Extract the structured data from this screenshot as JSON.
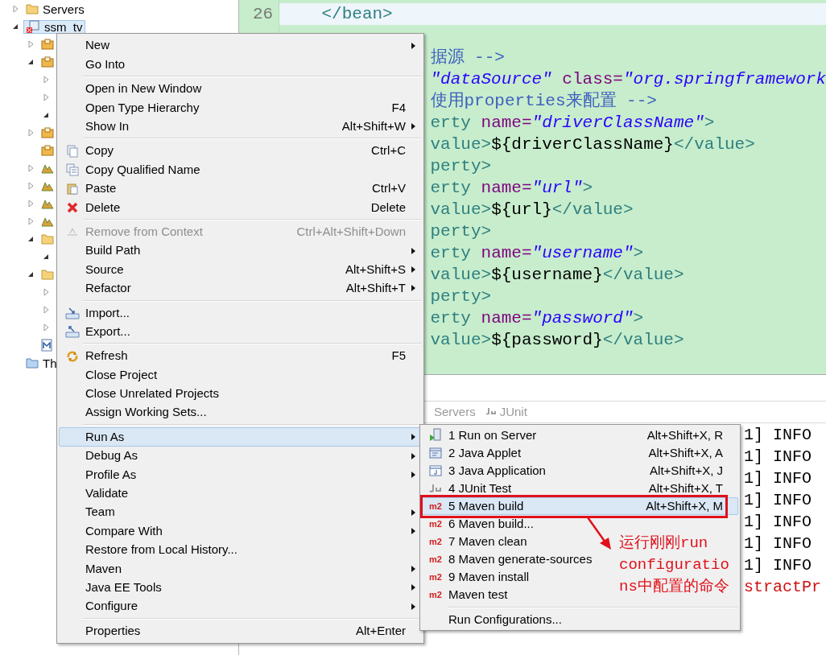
{
  "project_explorer": {
    "items": [
      {
        "label": "Servers",
        "kind": "folder",
        "expanded": false,
        "selected": false
      },
      {
        "label": "ssm_tv",
        "kind": "project",
        "expanded": true,
        "selected": true,
        "children": [
          {
            "kind": "package",
            "expanded": false,
            "selected": false
          },
          {
            "kind": "package",
            "expanded": true,
            "selected": false,
            "children": [
              {
                "expanded": false,
                "selected": false
              },
              {
                "expanded": false,
                "selected": false
              },
              {
                "expanded": true,
                "selected": false
              }
            ]
          },
          {
            "kind": "package",
            "expanded": false,
            "selected": false
          },
          {
            "kind": "package",
            "selected": false
          },
          {
            "kind": "library",
            "expanded": false,
            "selected": false
          },
          {
            "kind": "library",
            "expanded": false,
            "selected": false
          },
          {
            "kind": "library",
            "expanded": false,
            "selected": false
          },
          {
            "kind": "library",
            "expanded": false,
            "selected": false
          },
          {
            "kind": "folder",
            "expanded": true,
            "selected": false,
            "children": [
              {
                "expanded": true,
                "selected": false
              }
            ]
          },
          {
            "kind": "folder",
            "expanded": true,
            "selected": false,
            "children": [
              {
                "expanded": false,
                "selected": false
              },
              {
                "expanded": false,
                "selected": false
              },
              {
                "expanded": false,
                "selected": false
              }
            ]
          },
          {
            "kind": "maven-file",
            "selected": false
          }
        ]
      },
      {
        "label": "Th",
        "kind": "working-set",
        "selected": false
      }
    ]
  },
  "editor": {
    "lines": [
      {
        "number": "26",
        "current": true,
        "tokens": [
          {
            "kind": "tag",
            "text": "</bean>"
          }
        ]
      },
      {
        "current": false,
        "tokens": [
          {
            "kind": "comment",
            "text": "据源 -->"
          }
        ]
      },
      {
        "current": false,
        "tokens": [
          {
            "kind": "string",
            "text": "\"dataSource\""
          },
          {
            "kind": "attr",
            "text": " class="
          },
          {
            "kind": "string",
            "text": "\"org.springframework"
          }
        ]
      },
      {
        "current": false,
        "tokens": [
          {
            "kind": "comment",
            "text": "使用properties来配置 -->"
          }
        ]
      },
      {
        "current": false,
        "tokens": [
          {
            "kind": "tag",
            "text": "erty"
          },
          {
            "kind": "attr",
            "text": " name="
          },
          {
            "kind": "string",
            "text": "\"driverClassName\""
          },
          {
            "kind": "tag",
            "text": ">"
          }
        ]
      },
      {
        "current": false,
        "tokens": [
          {
            "kind": "tag",
            "text": "value>"
          },
          {
            "kind": "text",
            "text": "${driverClassName}"
          },
          {
            "kind": "tag",
            "text": "</value>"
          }
        ]
      },
      {
        "current": false,
        "tokens": [
          {
            "kind": "tag",
            "text": "perty>"
          }
        ]
      },
      {
        "current": false,
        "tokens": [
          {
            "kind": "tag",
            "text": "erty"
          },
          {
            "kind": "attr",
            "text": " name="
          },
          {
            "kind": "string",
            "text": "\"url\""
          },
          {
            "kind": "tag",
            "text": ">"
          }
        ]
      },
      {
        "current": false,
        "tokens": [
          {
            "kind": "tag",
            "text": "value>"
          },
          {
            "kind": "text",
            "text": "${url}"
          },
          {
            "kind": "tag",
            "text": "</value>"
          }
        ]
      },
      {
        "current": false,
        "tokens": [
          {
            "kind": "tag",
            "text": "perty>"
          }
        ]
      },
      {
        "current": false,
        "tokens": [
          {
            "kind": "tag",
            "text": "erty"
          },
          {
            "kind": "attr",
            "text": " name="
          },
          {
            "kind": "string",
            "text": "\"username\""
          },
          {
            "kind": "tag",
            "text": ">"
          }
        ]
      },
      {
        "current": false,
        "tokens": [
          {
            "kind": "tag",
            "text": "value>"
          },
          {
            "kind": "text",
            "text": "${username}"
          },
          {
            "kind": "tag",
            "text": "</value>"
          }
        ]
      },
      {
        "current": false,
        "tokens": [
          {
            "kind": "tag",
            "text": "perty>"
          }
        ]
      },
      {
        "current": false,
        "tokens": [
          {
            "kind": "tag",
            "text": "erty"
          },
          {
            "kind": "attr",
            "text": " name="
          },
          {
            "kind": "string",
            "text": "\"password\""
          },
          {
            "kind": "tag",
            "text": ">"
          }
        ]
      },
      {
        "current": false,
        "tokens": [
          {
            "kind": "tag",
            "text": "value>"
          },
          {
            "kind": "text",
            "text": "${password}"
          },
          {
            "kind": "tag",
            "text": "</value>"
          }
        ]
      }
    ]
  },
  "console": {
    "tabs": [
      {
        "label": "Servers"
      },
      {
        "label": "JUnit",
        "kind": "junit"
      }
    ],
    "lines": [
      {
        "text": "1] INFO",
        "kind": "info"
      },
      {
        "text": "1] INFO",
        "kind": "info"
      },
      {
        "text": "1] INFO",
        "kind": "info"
      },
      {
        "text": "1] INFO",
        "kind": "info"
      },
      {
        "text": "1] INFO",
        "kind": "info"
      },
      {
        "text": "1] INFO",
        "kind": "info"
      },
      {
        "text": "1] INFO",
        "kind": "info"
      },
      {
        "text": "stractPr",
        "kind": "error"
      }
    ]
  },
  "context_menu": {
    "groups": [
      [
        {
          "label": "New",
          "submenu": true,
          "selected": false,
          "disabled": false
        },
        {
          "label": "Go Into",
          "submenu": false,
          "selected": false,
          "disabled": false
        }
      ],
      [
        {
          "label": "Open in New Window",
          "submenu": false,
          "selected": false,
          "disabled": false
        },
        {
          "label": "Open Type Hierarchy",
          "shortcut": "F4",
          "submenu": false,
          "selected": false,
          "disabled": false
        },
        {
          "label": "Show In",
          "shortcut": "Alt+Shift+W",
          "submenu": true,
          "selected": false,
          "disabled": false
        }
      ],
      [
        {
          "label": "Copy",
          "shortcut": "Ctrl+C",
          "submenu": false,
          "kind": "copy",
          "selected": false,
          "disabled": false
        },
        {
          "label": "Copy Qualified Name",
          "submenu": false,
          "kind": "copy-qualified",
          "selected": false,
          "disabled": false
        },
        {
          "label": "Paste",
          "shortcut": "Ctrl+V",
          "submenu": false,
          "kind": "paste",
          "selected": false,
          "disabled": false
        },
        {
          "label": "Delete",
          "shortcut": "Delete",
          "submenu": false,
          "kind": "delete",
          "selected": false,
          "disabled": false
        }
      ],
      [
        {
          "label": "Remove from Context",
          "shortcut": "Ctrl+Alt+Shift+Down",
          "submenu": false,
          "kind": "remove",
          "selected": false,
          "disabled": true
        },
        {
          "label": "Build Path",
          "submenu": true,
          "selected": false,
          "disabled": false
        },
        {
          "label": "Source",
          "shortcut": "Alt+Shift+S",
          "submenu": true,
          "selected": false,
          "disabled": false
        },
        {
          "label": "Refactor",
          "shortcut": "Alt+Shift+T",
          "submenu": true,
          "selected": false,
          "disabled": false
        }
      ],
      [
        {
          "label": "Import...",
          "submenu": false,
          "kind": "import",
          "selected": false,
          "disabled": false
        },
        {
          "label": "Export...",
          "submenu": false,
          "kind": "export",
          "selected": false,
          "disabled": false
        }
      ],
      [
        {
          "label": "Refresh",
          "shortcut": "F5",
          "submenu": false,
          "kind": "refresh",
          "selected": false,
          "disabled": false
        },
        {
          "label": "Close Project",
          "submenu": false,
          "selected": false,
          "disabled": false
        },
        {
          "label": "Close Unrelated Projects",
          "submenu": false,
          "selected": false,
          "disabled": false
        },
        {
          "label": "Assign Working Sets...",
          "submenu": false,
          "selected": false,
          "disabled": false
        }
      ],
      [
        {
          "label": "Run As",
          "submenu": true,
          "selected": true,
          "disabled": false
        },
        {
          "label": "Debug As",
          "submenu": true,
          "selected": false,
          "disabled": false
        },
        {
          "label": "Profile As",
          "submenu": true,
          "selected": false,
          "disabled": false
        },
        {
          "label": "Validate",
          "submenu": false,
          "selected": false,
          "disabled": false
        },
        {
          "label": "Team",
          "submenu": true,
          "selected": false,
          "disabled": false
        },
        {
          "label": "Compare With",
          "submenu": true,
          "selected": false,
          "disabled": false
        },
        {
          "label": "Restore from Local History...",
          "submenu": false,
          "selected": false,
          "disabled": false
        },
        {
          "label": "Maven",
          "submenu": true,
          "selected": false,
          "disabled": false
        },
        {
          "label": "Java EE Tools",
          "submenu": true,
          "selected": false,
          "disabled": false
        },
        {
          "label": "Configure",
          "submenu": true,
          "selected": false,
          "disabled": false
        }
      ],
      [
        {
          "label": "Properties",
          "shortcut": "Alt+Enter",
          "submenu": false,
          "selected": false,
          "disabled": false
        }
      ]
    ]
  },
  "run_as_submenu": {
    "groups": [
      [
        {
          "label": "1 Run on Server",
          "shortcut": "Alt+Shift+X, R",
          "kind": "server",
          "selected": false
        },
        {
          "label": "2 Java Applet",
          "shortcut": "Alt+Shift+X, A",
          "kind": "applet",
          "selected": false
        },
        {
          "label": "3 Java Application",
          "shortcut": "Alt+Shift+X, J",
          "kind": "application",
          "selected": false
        },
        {
          "label": "4 JUnit Test",
          "shortcut": "Alt+Shift+X, T",
          "kind": "junit",
          "selected": false
        },
        {
          "label": "5 Maven build",
          "shortcut": "Alt+Shift+X, M",
          "kind": "maven",
          "icon_label": "m2",
          "selected": true
        },
        {
          "label": "6 Maven build...",
          "kind": "maven",
          "icon_label": "m2",
          "selected": false
        },
        {
          "label": "7 Maven clean",
          "kind": "maven",
          "icon_label": "m2",
          "selected": false
        },
        {
          "label": "8 Maven generate-sources",
          "kind": "maven",
          "icon_label": "m2",
          "selected": false
        },
        {
          "label": "9 Maven install",
          "kind": "maven",
          "icon_label": "m2",
          "selected": false
        },
        {
          "label": "Maven test",
          "kind": "maven",
          "icon_label": "m2",
          "selected": false
        }
      ],
      [
        {
          "label": "Run Configurations...",
          "selected": false
        }
      ]
    ]
  },
  "annotation": {
    "text": "运行刚刚run configurations中配置的命令"
  }
}
